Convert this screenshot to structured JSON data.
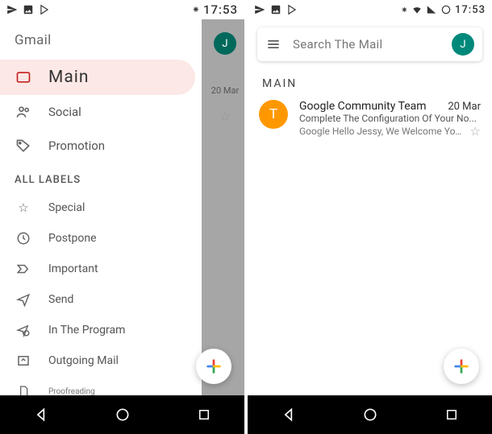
{
  "left": {
    "status_time": "17:53",
    "drawer_title": "Gmail",
    "items": [
      {
        "label": "Main"
      },
      {
        "label": "Social"
      },
      {
        "label": "Promotion"
      }
    ],
    "section_header": "ALL LABELS",
    "labels": [
      {
        "label": "Special"
      },
      {
        "label": "Postpone"
      },
      {
        "label": "Important"
      },
      {
        "label": "Send"
      },
      {
        "label": "In The Program"
      },
      {
        "label": "Outgoing Mail"
      },
      {
        "label": "Proofreading"
      }
    ],
    "peek_avatar": "J",
    "peek_date": "20 Mar"
  },
  "right": {
    "status_time": "17:53",
    "search_placeholder": "Search The Mail",
    "avatar_letter": "J",
    "inbox_label": "MAIN",
    "email": {
      "avatar_letter": "T",
      "sender": "Google Community Team",
      "date": "20 Mar",
      "subject": "Complete The Configuration Of Your No...",
      "preview": "Google Hello Jessy, We Welcome You..."
    }
  }
}
